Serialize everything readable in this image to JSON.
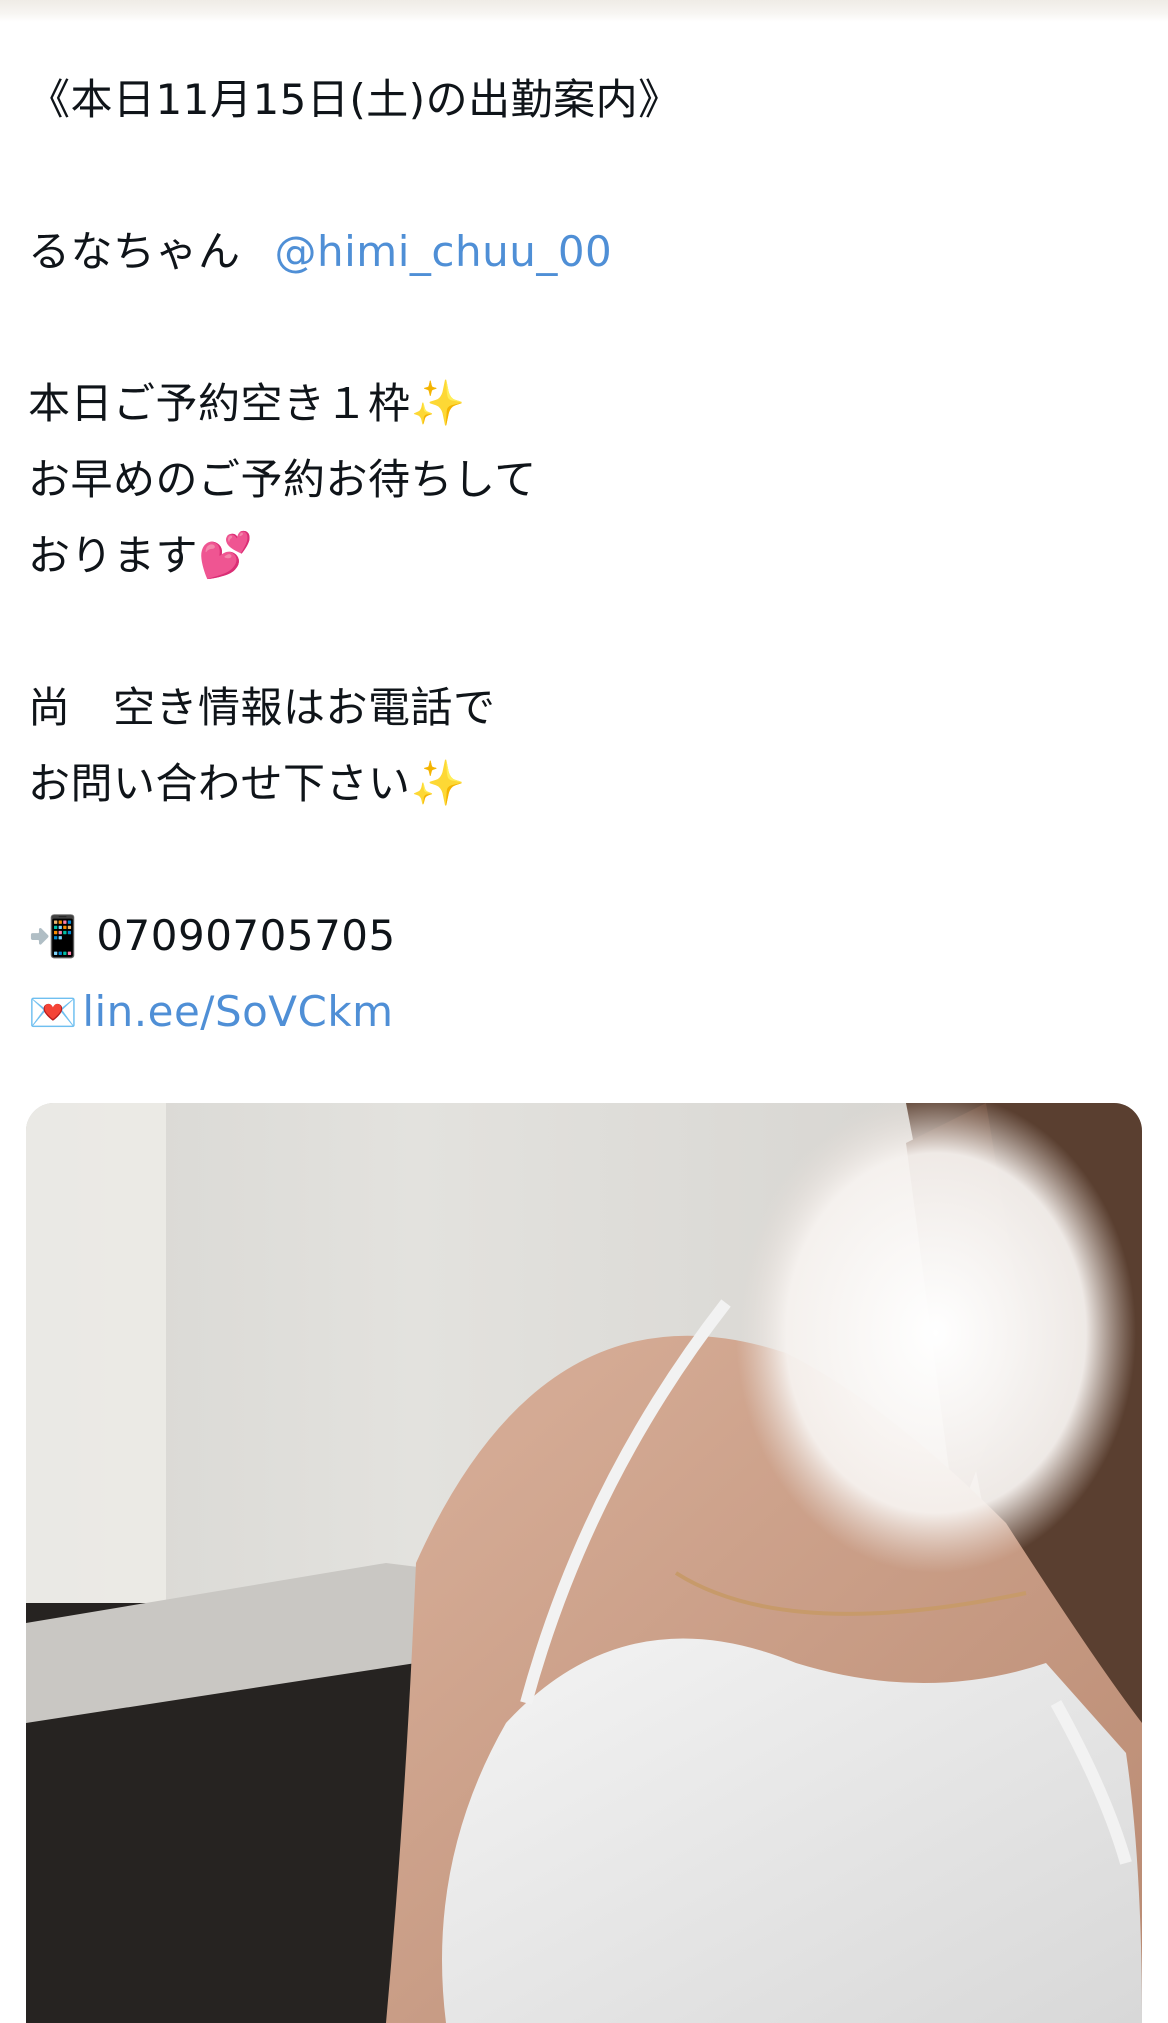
{
  "tweet": {
    "line_header": "《本日11月15日(土)の出勤案内》",
    "name_text": "るなちゃん",
    "mention": "@himi_chuu_00",
    "availability_line1": "本日ご予約空き１枠",
    "availability_line2": "お早めのご予約お待ちして",
    "availability_line3": "おります",
    "note_line1": "尚　空き情報はお電話で",
    "note_line2": "お問い合わせ下さい",
    "phone_number": "07090705705",
    "line_link": "lin.ee/SoVCkm",
    "emoji_sparkles": "✨",
    "emoji_hearts": "💕",
    "emoji_phone": "📲",
    "emoji_love_letter": "💌"
  },
  "colors": {
    "link": "#4f8fd6",
    "text": "#0f1419",
    "background": "#ffffff"
  },
  "media": {
    "type": "photo",
    "icon": "attached-photo"
  }
}
